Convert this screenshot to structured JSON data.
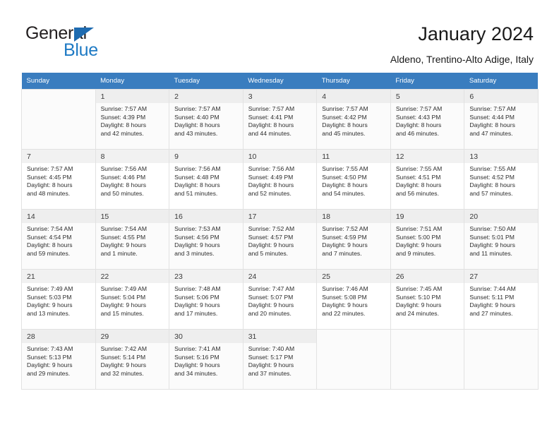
{
  "brand": {
    "name_top": "General",
    "name_bottom": "Blue",
    "triangle_color": "#1e6bb0",
    "blue_text_color": "#1e7ac4"
  },
  "header": {
    "title": "January 2024",
    "location": "Aldeno, Trentino-Alto Adige, Italy"
  },
  "calendar": {
    "header_bg": "#3a7dbf",
    "weekdays": [
      "Sunday",
      "Monday",
      "Tuesday",
      "Wednesday",
      "Thursday",
      "Friday",
      "Saturday"
    ],
    "labels": {
      "sunrise": "Sunrise:",
      "sunset": "Sunset:",
      "daylight": "Daylight:"
    },
    "weeks": [
      [
        {
          "day": "",
          "empty": true
        },
        {
          "day": "1",
          "sunrise": "Sunrise: 7:57 AM",
          "sunset": "Sunset: 4:39 PM",
          "daylight_1": "Daylight: 8 hours",
          "daylight_2": "and 42 minutes."
        },
        {
          "day": "2",
          "sunrise": "Sunrise: 7:57 AM",
          "sunset": "Sunset: 4:40 PM",
          "daylight_1": "Daylight: 8 hours",
          "daylight_2": "and 43 minutes."
        },
        {
          "day": "3",
          "sunrise": "Sunrise: 7:57 AM",
          "sunset": "Sunset: 4:41 PM",
          "daylight_1": "Daylight: 8 hours",
          "daylight_2": "and 44 minutes."
        },
        {
          "day": "4",
          "sunrise": "Sunrise: 7:57 AM",
          "sunset": "Sunset: 4:42 PM",
          "daylight_1": "Daylight: 8 hours",
          "daylight_2": "and 45 minutes."
        },
        {
          "day": "5",
          "sunrise": "Sunrise: 7:57 AM",
          "sunset": "Sunset: 4:43 PM",
          "daylight_1": "Daylight: 8 hours",
          "daylight_2": "and 46 minutes."
        },
        {
          "day": "6",
          "sunrise": "Sunrise: 7:57 AM",
          "sunset": "Sunset: 4:44 PM",
          "daylight_1": "Daylight: 8 hours",
          "daylight_2": "and 47 minutes."
        }
      ],
      [
        {
          "day": "7",
          "sunrise": "Sunrise: 7:57 AM",
          "sunset": "Sunset: 4:45 PM",
          "daylight_1": "Daylight: 8 hours",
          "daylight_2": "and 48 minutes."
        },
        {
          "day": "8",
          "sunrise": "Sunrise: 7:56 AM",
          "sunset": "Sunset: 4:46 PM",
          "daylight_1": "Daylight: 8 hours",
          "daylight_2": "and 50 minutes."
        },
        {
          "day": "9",
          "sunrise": "Sunrise: 7:56 AM",
          "sunset": "Sunset: 4:48 PM",
          "daylight_1": "Daylight: 8 hours",
          "daylight_2": "and 51 minutes."
        },
        {
          "day": "10",
          "sunrise": "Sunrise: 7:56 AM",
          "sunset": "Sunset: 4:49 PM",
          "daylight_1": "Daylight: 8 hours",
          "daylight_2": "and 52 minutes."
        },
        {
          "day": "11",
          "sunrise": "Sunrise: 7:55 AM",
          "sunset": "Sunset: 4:50 PM",
          "daylight_1": "Daylight: 8 hours",
          "daylight_2": "and 54 minutes."
        },
        {
          "day": "12",
          "sunrise": "Sunrise: 7:55 AM",
          "sunset": "Sunset: 4:51 PM",
          "daylight_1": "Daylight: 8 hours",
          "daylight_2": "and 56 minutes."
        },
        {
          "day": "13",
          "sunrise": "Sunrise: 7:55 AM",
          "sunset": "Sunset: 4:52 PM",
          "daylight_1": "Daylight: 8 hours",
          "daylight_2": "and 57 minutes."
        }
      ],
      [
        {
          "day": "14",
          "sunrise": "Sunrise: 7:54 AM",
          "sunset": "Sunset: 4:54 PM",
          "daylight_1": "Daylight: 8 hours",
          "daylight_2": "and 59 minutes."
        },
        {
          "day": "15",
          "sunrise": "Sunrise: 7:54 AM",
          "sunset": "Sunset: 4:55 PM",
          "daylight_1": "Daylight: 9 hours",
          "daylight_2": "and 1 minute."
        },
        {
          "day": "16",
          "sunrise": "Sunrise: 7:53 AM",
          "sunset": "Sunset: 4:56 PM",
          "daylight_1": "Daylight: 9 hours",
          "daylight_2": "and 3 minutes."
        },
        {
          "day": "17",
          "sunrise": "Sunrise: 7:52 AM",
          "sunset": "Sunset: 4:57 PM",
          "daylight_1": "Daylight: 9 hours",
          "daylight_2": "and 5 minutes."
        },
        {
          "day": "18",
          "sunrise": "Sunrise: 7:52 AM",
          "sunset": "Sunset: 4:59 PM",
          "daylight_1": "Daylight: 9 hours",
          "daylight_2": "and 7 minutes."
        },
        {
          "day": "19",
          "sunrise": "Sunrise: 7:51 AM",
          "sunset": "Sunset: 5:00 PM",
          "daylight_1": "Daylight: 9 hours",
          "daylight_2": "and 9 minutes."
        },
        {
          "day": "20",
          "sunrise": "Sunrise: 7:50 AM",
          "sunset": "Sunset: 5:01 PM",
          "daylight_1": "Daylight: 9 hours",
          "daylight_2": "and 11 minutes."
        }
      ],
      [
        {
          "day": "21",
          "sunrise": "Sunrise: 7:49 AM",
          "sunset": "Sunset: 5:03 PM",
          "daylight_1": "Daylight: 9 hours",
          "daylight_2": "and 13 minutes."
        },
        {
          "day": "22",
          "sunrise": "Sunrise: 7:49 AM",
          "sunset": "Sunset: 5:04 PM",
          "daylight_1": "Daylight: 9 hours",
          "daylight_2": "and 15 minutes."
        },
        {
          "day": "23",
          "sunrise": "Sunrise: 7:48 AM",
          "sunset": "Sunset: 5:06 PM",
          "daylight_1": "Daylight: 9 hours",
          "daylight_2": "and 17 minutes."
        },
        {
          "day": "24",
          "sunrise": "Sunrise: 7:47 AM",
          "sunset": "Sunset: 5:07 PM",
          "daylight_1": "Daylight: 9 hours",
          "daylight_2": "and 20 minutes."
        },
        {
          "day": "25",
          "sunrise": "Sunrise: 7:46 AM",
          "sunset": "Sunset: 5:08 PM",
          "daylight_1": "Daylight: 9 hours",
          "daylight_2": "and 22 minutes."
        },
        {
          "day": "26",
          "sunrise": "Sunrise: 7:45 AM",
          "sunset": "Sunset: 5:10 PM",
          "daylight_1": "Daylight: 9 hours",
          "daylight_2": "and 24 minutes."
        },
        {
          "day": "27",
          "sunrise": "Sunrise: 7:44 AM",
          "sunset": "Sunset: 5:11 PM",
          "daylight_1": "Daylight: 9 hours",
          "daylight_2": "and 27 minutes."
        }
      ],
      [
        {
          "day": "28",
          "sunrise": "Sunrise: 7:43 AM",
          "sunset": "Sunset: 5:13 PM",
          "daylight_1": "Daylight: 9 hours",
          "daylight_2": "and 29 minutes."
        },
        {
          "day": "29",
          "sunrise": "Sunrise: 7:42 AM",
          "sunset": "Sunset: 5:14 PM",
          "daylight_1": "Daylight: 9 hours",
          "daylight_2": "and 32 minutes."
        },
        {
          "day": "30",
          "sunrise": "Sunrise: 7:41 AM",
          "sunset": "Sunset: 5:16 PM",
          "daylight_1": "Daylight: 9 hours",
          "daylight_2": "and 34 minutes."
        },
        {
          "day": "31",
          "sunrise": "Sunrise: 7:40 AM",
          "sunset": "Sunset: 5:17 PM",
          "daylight_1": "Daylight: 9 hours",
          "daylight_2": "and 37 minutes."
        },
        {
          "day": "",
          "empty": true
        },
        {
          "day": "",
          "empty": true
        },
        {
          "day": "",
          "empty": true
        }
      ]
    ]
  }
}
